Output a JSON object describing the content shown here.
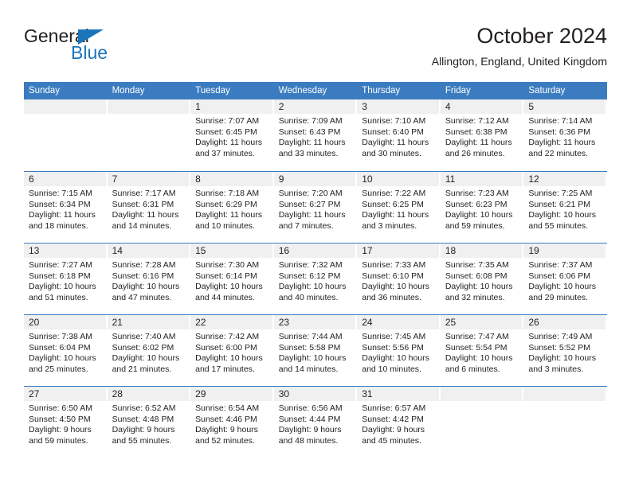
{
  "brand": {
    "name_top": "General",
    "name_bottom": "Blue",
    "accent_color": "#1b75bb"
  },
  "header": {
    "title": "October 2024",
    "location": "Allington, England, United Kingdom"
  },
  "theme": {
    "header_blue": "#3b7cc0",
    "daystrip_gray": "#f0f0f0",
    "text_color": "#231f20"
  },
  "weekday_headers": [
    "Sunday",
    "Monday",
    "Tuesday",
    "Wednesday",
    "Thursday",
    "Friday",
    "Saturday"
  ],
  "weeks": [
    [
      {
        "day": "",
        "sunrise": "",
        "sunset": "",
        "daylight_line1": "",
        "daylight_line2": ""
      },
      {
        "day": "",
        "sunrise": "",
        "sunset": "",
        "daylight_line1": "",
        "daylight_line2": ""
      },
      {
        "day": "1",
        "sunrise": "Sunrise: 7:07 AM",
        "sunset": "Sunset: 6:45 PM",
        "daylight_line1": "Daylight: 11 hours",
        "daylight_line2": "and 37 minutes."
      },
      {
        "day": "2",
        "sunrise": "Sunrise: 7:09 AM",
        "sunset": "Sunset: 6:43 PM",
        "daylight_line1": "Daylight: 11 hours",
        "daylight_line2": "and 33 minutes."
      },
      {
        "day": "3",
        "sunrise": "Sunrise: 7:10 AM",
        "sunset": "Sunset: 6:40 PM",
        "daylight_line1": "Daylight: 11 hours",
        "daylight_line2": "and 30 minutes."
      },
      {
        "day": "4",
        "sunrise": "Sunrise: 7:12 AM",
        "sunset": "Sunset: 6:38 PM",
        "daylight_line1": "Daylight: 11 hours",
        "daylight_line2": "and 26 minutes."
      },
      {
        "day": "5",
        "sunrise": "Sunrise: 7:14 AM",
        "sunset": "Sunset: 6:36 PM",
        "daylight_line1": "Daylight: 11 hours",
        "daylight_line2": "and 22 minutes."
      }
    ],
    [
      {
        "day": "6",
        "sunrise": "Sunrise: 7:15 AM",
        "sunset": "Sunset: 6:34 PM",
        "daylight_line1": "Daylight: 11 hours",
        "daylight_line2": "and 18 minutes."
      },
      {
        "day": "7",
        "sunrise": "Sunrise: 7:17 AM",
        "sunset": "Sunset: 6:31 PM",
        "daylight_line1": "Daylight: 11 hours",
        "daylight_line2": "and 14 minutes."
      },
      {
        "day": "8",
        "sunrise": "Sunrise: 7:18 AM",
        "sunset": "Sunset: 6:29 PM",
        "daylight_line1": "Daylight: 11 hours",
        "daylight_line2": "and 10 minutes."
      },
      {
        "day": "9",
        "sunrise": "Sunrise: 7:20 AM",
        "sunset": "Sunset: 6:27 PM",
        "daylight_line1": "Daylight: 11 hours",
        "daylight_line2": "and 7 minutes."
      },
      {
        "day": "10",
        "sunrise": "Sunrise: 7:22 AM",
        "sunset": "Sunset: 6:25 PM",
        "daylight_line1": "Daylight: 11 hours",
        "daylight_line2": "and 3 minutes."
      },
      {
        "day": "11",
        "sunrise": "Sunrise: 7:23 AM",
        "sunset": "Sunset: 6:23 PM",
        "daylight_line1": "Daylight: 10 hours",
        "daylight_line2": "and 59 minutes."
      },
      {
        "day": "12",
        "sunrise": "Sunrise: 7:25 AM",
        "sunset": "Sunset: 6:21 PM",
        "daylight_line1": "Daylight: 10 hours",
        "daylight_line2": "and 55 minutes."
      }
    ],
    [
      {
        "day": "13",
        "sunrise": "Sunrise: 7:27 AM",
        "sunset": "Sunset: 6:18 PM",
        "daylight_line1": "Daylight: 10 hours",
        "daylight_line2": "and 51 minutes."
      },
      {
        "day": "14",
        "sunrise": "Sunrise: 7:28 AM",
        "sunset": "Sunset: 6:16 PM",
        "daylight_line1": "Daylight: 10 hours",
        "daylight_line2": "and 47 minutes."
      },
      {
        "day": "15",
        "sunrise": "Sunrise: 7:30 AM",
        "sunset": "Sunset: 6:14 PM",
        "daylight_line1": "Daylight: 10 hours",
        "daylight_line2": "and 44 minutes."
      },
      {
        "day": "16",
        "sunrise": "Sunrise: 7:32 AM",
        "sunset": "Sunset: 6:12 PM",
        "daylight_line1": "Daylight: 10 hours",
        "daylight_line2": "and 40 minutes."
      },
      {
        "day": "17",
        "sunrise": "Sunrise: 7:33 AM",
        "sunset": "Sunset: 6:10 PM",
        "daylight_line1": "Daylight: 10 hours",
        "daylight_line2": "and 36 minutes."
      },
      {
        "day": "18",
        "sunrise": "Sunrise: 7:35 AM",
        "sunset": "Sunset: 6:08 PM",
        "daylight_line1": "Daylight: 10 hours",
        "daylight_line2": "and 32 minutes."
      },
      {
        "day": "19",
        "sunrise": "Sunrise: 7:37 AM",
        "sunset": "Sunset: 6:06 PM",
        "daylight_line1": "Daylight: 10 hours",
        "daylight_line2": "and 29 minutes."
      }
    ],
    [
      {
        "day": "20",
        "sunrise": "Sunrise: 7:38 AM",
        "sunset": "Sunset: 6:04 PM",
        "daylight_line1": "Daylight: 10 hours",
        "daylight_line2": "and 25 minutes."
      },
      {
        "day": "21",
        "sunrise": "Sunrise: 7:40 AM",
        "sunset": "Sunset: 6:02 PM",
        "daylight_line1": "Daylight: 10 hours",
        "daylight_line2": "and 21 minutes."
      },
      {
        "day": "22",
        "sunrise": "Sunrise: 7:42 AM",
        "sunset": "Sunset: 6:00 PM",
        "daylight_line1": "Daylight: 10 hours",
        "daylight_line2": "and 17 minutes."
      },
      {
        "day": "23",
        "sunrise": "Sunrise: 7:44 AM",
        "sunset": "Sunset: 5:58 PM",
        "daylight_line1": "Daylight: 10 hours",
        "daylight_line2": "and 14 minutes."
      },
      {
        "day": "24",
        "sunrise": "Sunrise: 7:45 AM",
        "sunset": "Sunset: 5:56 PM",
        "daylight_line1": "Daylight: 10 hours",
        "daylight_line2": "and 10 minutes."
      },
      {
        "day": "25",
        "sunrise": "Sunrise: 7:47 AM",
        "sunset": "Sunset: 5:54 PM",
        "daylight_line1": "Daylight: 10 hours",
        "daylight_line2": "and 6 minutes."
      },
      {
        "day": "26",
        "sunrise": "Sunrise: 7:49 AM",
        "sunset": "Sunset: 5:52 PM",
        "daylight_line1": "Daylight: 10 hours",
        "daylight_line2": "and 3 minutes."
      }
    ],
    [
      {
        "day": "27",
        "sunrise": "Sunrise: 6:50 AM",
        "sunset": "Sunset: 4:50 PM",
        "daylight_line1": "Daylight: 9 hours",
        "daylight_line2": "and 59 minutes."
      },
      {
        "day": "28",
        "sunrise": "Sunrise: 6:52 AM",
        "sunset": "Sunset: 4:48 PM",
        "daylight_line1": "Daylight: 9 hours",
        "daylight_line2": "and 55 minutes."
      },
      {
        "day": "29",
        "sunrise": "Sunrise: 6:54 AM",
        "sunset": "Sunset: 4:46 PM",
        "daylight_line1": "Daylight: 9 hours",
        "daylight_line2": "and 52 minutes."
      },
      {
        "day": "30",
        "sunrise": "Sunrise: 6:56 AM",
        "sunset": "Sunset: 4:44 PM",
        "daylight_line1": "Daylight: 9 hours",
        "daylight_line2": "and 48 minutes."
      },
      {
        "day": "31",
        "sunrise": "Sunrise: 6:57 AM",
        "sunset": "Sunset: 4:42 PM",
        "daylight_line1": "Daylight: 9 hours",
        "daylight_line2": "and 45 minutes."
      },
      {
        "day": "",
        "sunrise": "",
        "sunset": "",
        "daylight_line1": "",
        "daylight_line2": ""
      },
      {
        "day": "",
        "sunrise": "",
        "sunset": "",
        "daylight_line1": "",
        "daylight_line2": ""
      }
    ]
  ]
}
